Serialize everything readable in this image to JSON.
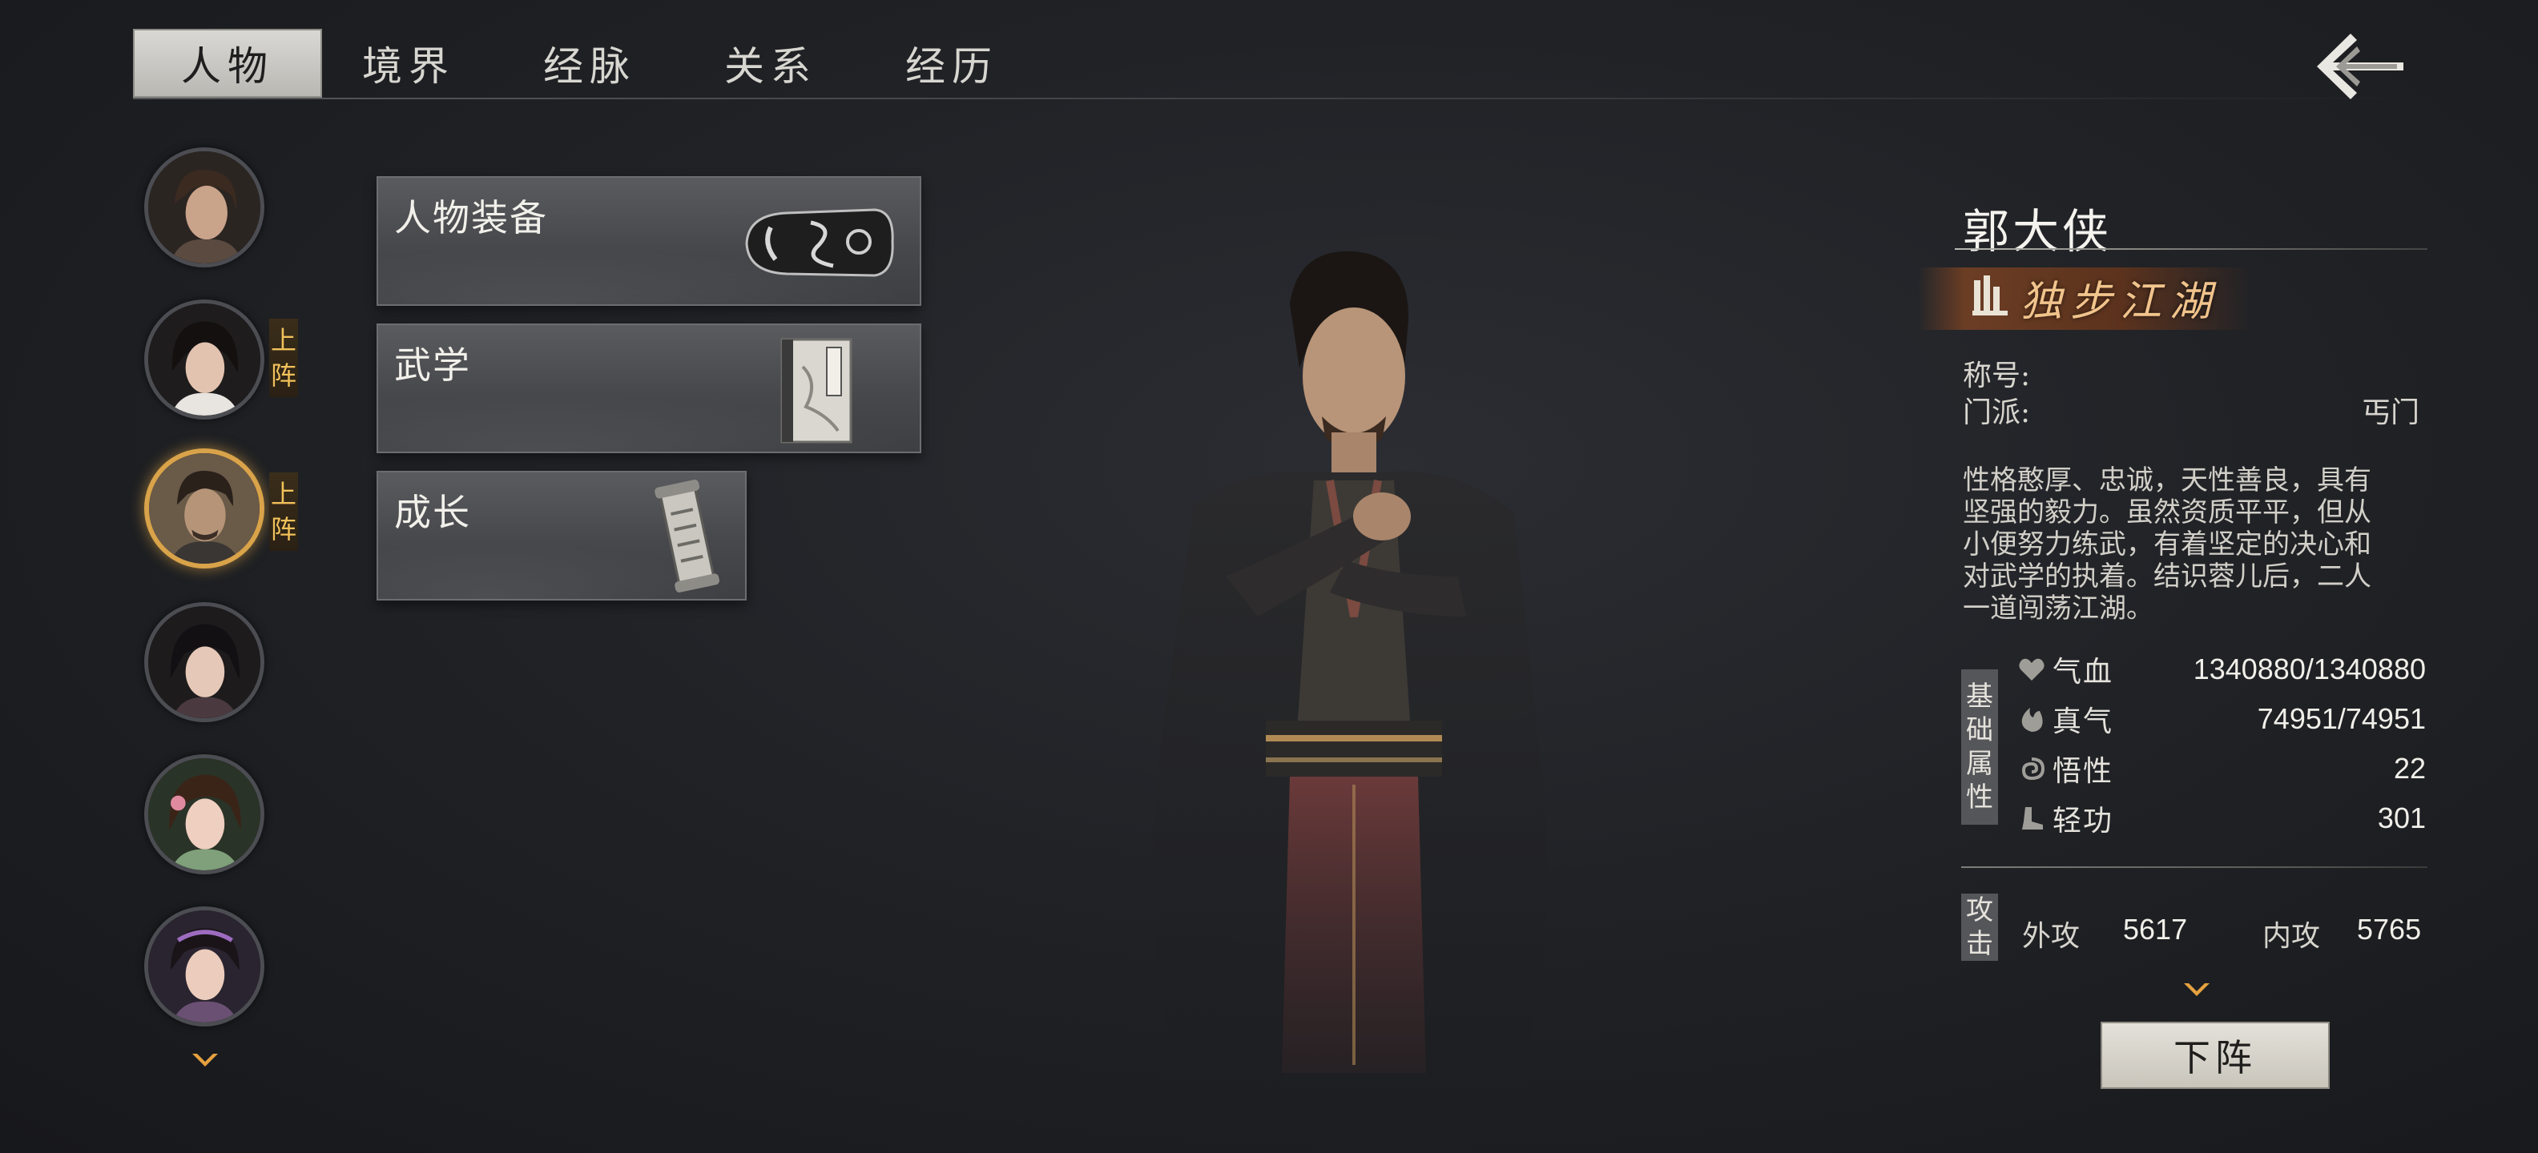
{
  "tabs": [
    {
      "label": "人物",
      "active": true
    },
    {
      "label": "境界",
      "active": false
    },
    {
      "label": "经脉",
      "active": false
    },
    {
      "label": "关系",
      "active": false
    },
    {
      "label": "经历",
      "active": false
    }
  ],
  "back_icon": "back-arrow-icon",
  "roster": {
    "members": [
      {
        "name_hint": "portrait-1",
        "badge": ""
      },
      {
        "name_hint": "portrait-2",
        "badge": "上阵"
      },
      {
        "name_hint": "portrait-3",
        "badge": "上阵",
        "selected": true
      },
      {
        "name_hint": "portrait-4",
        "badge": ""
      },
      {
        "name_hint": "portrait-5",
        "badge": ""
      },
      {
        "name_hint": "portrait-6",
        "badge": ""
      }
    ],
    "badge_text": [
      "上",
      "阵"
    ],
    "more_icon": "chevron-down-icon"
  },
  "menu": [
    {
      "label": "人物装备",
      "icon": "bracer-icon"
    },
    {
      "label": "武学",
      "icon": "manual-book-icon"
    },
    {
      "label": "成长",
      "icon": "scroll-icon"
    }
  ],
  "character": {
    "name": "郭大侠",
    "title_badge": "独步江湖",
    "honor_label": "称号:",
    "honor_value": "",
    "sect_label": "门派:",
    "sect_value": "丐门",
    "bio": "性格憨厚、忠诚，天性善良，具有坚强的毅力。虽然资质平平，但从小便努力练武，有着坚定的决心和对武学的执着。结识蓉儿后，二人一道闯荡江湖。",
    "basic_attr_label": [
      "基",
      "础",
      "属",
      "性"
    ],
    "attrs": [
      {
        "icon": "heart-icon",
        "name": "气血",
        "value": "1340880/1340880"
      },
      {
        "icon": "flame-qi-icon",
        "name": "真气",
        "value": "74951/74951"
      },
      {
        "icon": "swirl-icon",
        "name": "悟性",
        "value": "22"
      },
      {
        "icon": "boot-icon",
        "name": "轻功",
        "value": "301"
      }
    ],
    "attack_label": [
      "攻",
      "击"
    ],
    "attack": [
      {
        "name": "外攻",
        "value": "5617"
      },
      {
        "name": "内攻",
        "value": "5765"
      }
    ]
  },
  "retire_button": "下阵",
  "colors": {
    "accent_gold": "#d9a34a",
    "badge_text": "#f1c15a",
    "title_text": "#f1c48c"
  }
}
